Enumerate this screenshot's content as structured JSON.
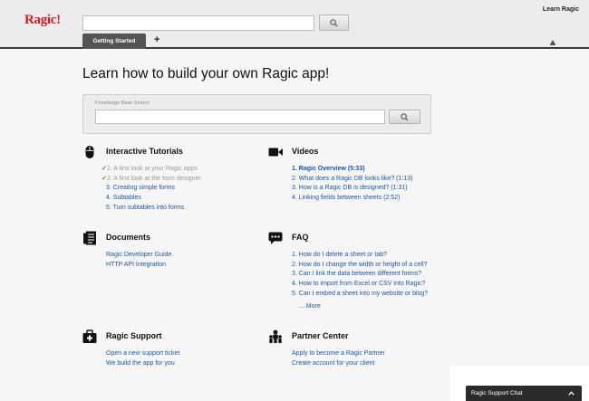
{
  "app": {
    "logo": "Ragic!"
  },
  "header": {
    "search_value": "",
    "learn_link": "Learn Ragic",
    "active_tab": "Getting Started",
    "add_tab": "+"
  },
  "main": {
    "title": "Learn how to build your own Ragic app!",
    "kb_search": {
      "label": "Knowledge Base Search",
      "value": ""
    }
  },
  "sections": {
    "tutorials": {
      "title": "Interactive Tutorials",
      "icon": "mouse-icon",
      "items": [
        {
          "label": "1. A first look at your Ragic apps",
          "done": true
        },
        {
          "label": "2. A first look at the form designer",
          "done": true
        },
        {
          "label": "3. Creating simple forms",
          "done": false
        },
        {
          "label": "4. Subtables",
          "done": false
        },
        {
          "label": "5. Turn subtables into forms",
          "done": false
        }
      ]
    },
    "videos": {
      "title": "Videos",
      "icon": "video-camera-icon",
      "items": [
        "1. Ragic Overview (5:33)",
        "2. What does a Ragic DB looks like? (1:13)",
        "3. How is a Ragic DB is designed? (1:31)",
        "4. Linking fields between sheets (2:52)"
      ]
    },
    "documents": {
      "title": "Documents",
      "icon": "documents-icon",
      "items": [
        "Ragic Developer Guide",
        "HTTP API Integration"
      ]
    },
    "faq": {
      "title": "FAQ",
      "icon": "speech-bubble-icon",
      "items": [
        "1. How do I delete a sheet or tab?",
        "2. How do I change the width or height of a cell?",
        "3. Can I link the data between different forms?",
        "4. How to import from Excel or CSV into Ragic?",
        "5. Can I embed a sheet into my website or blog?"
      ],
      "more": "....More"
    },
    "support": {
      "title": "Ragic Support",
      "icon": "first-aid-kit-icon",
      "items": [
        "Open a new support ticket",
        "We build the app for you"
      ]
    },
    "partner": {
      "title": "Partner Center",
      "icon": "partners-icon",
      "items": [
        "Apply to become a Ragic Partner",
        "Create account for your client"
      ]
    }
  },
  "chat": {
    "label": "Ragic Support Chat"
  },
  "colors": {
    "brand": "#d71920",
    "link": "#1b57a8",
    "check": "#4a9d2e",
    "tab": "#545454"
  }
}
